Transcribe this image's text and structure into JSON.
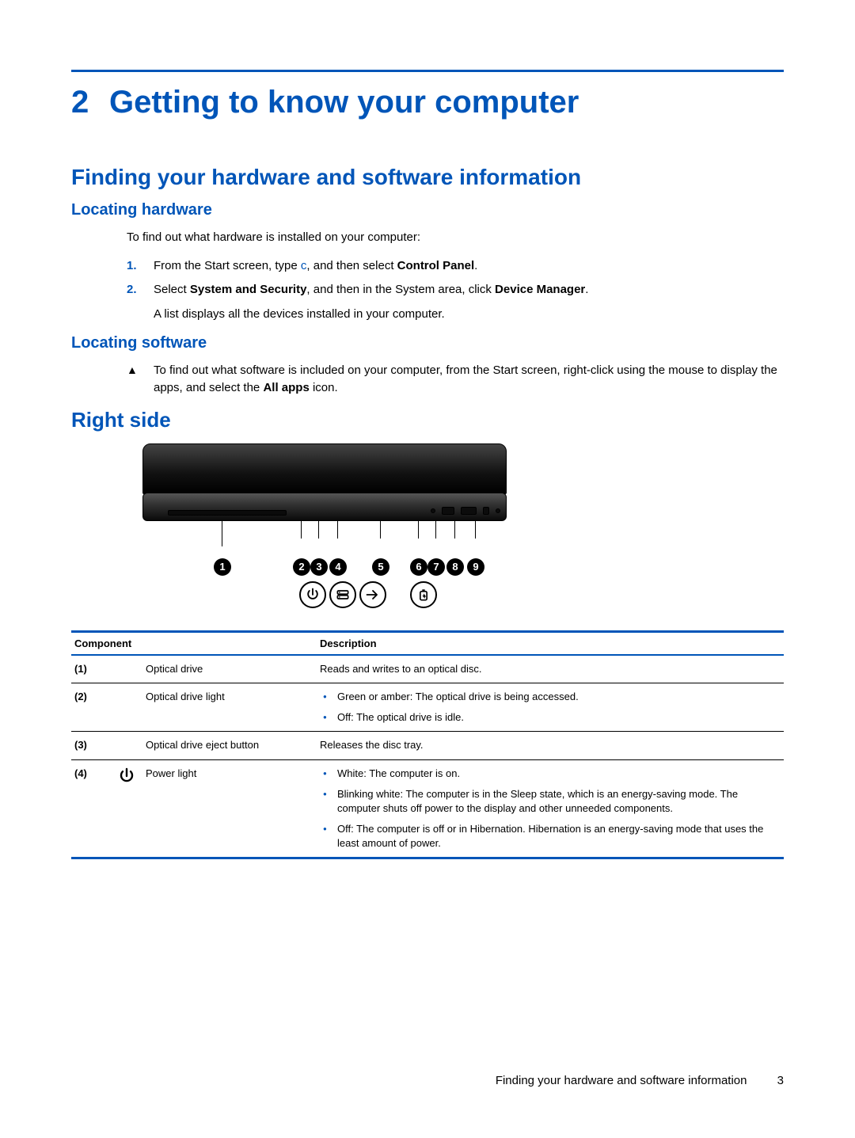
{
  "chapter": {
    "number": "2",
    "title": "Getting to know your computer"
  },
  "section1": {
    "title": "Finding your hardware and software information",
    "sub1": {
      "title": "Locating hardware",
      "intro": "To find out what hardware is installed on your computer:",
      "steps": [
        {
          "n": "1.",
          "pre": "From the Start screen, type ",
          "code": "c",
          "post1": ", and then select ",
          "bold1": "Control Panel",
          "tail": "."
        },
        {
          "n": "2.",
          "pre": "Select ",
          "bold1": "System and Security",
          "mid": ", and then in the System area, click ",
          "bold2": "Device Manager",
          "tail": "."
        }
      ],
      "after": "A list displays all the devices installed in your computer."
    },
    "sub2": {
      "title": "Locating software",
      "note_pre": "To find out what software is included on your computer, from the Start screen, right-click using the mouse to display the apps, and select the ",
      "note_bold": "All apps",
      "note_post": " icon."
    }
  },
  "section2": {
    "title": "Right side"
  },
  "callouts": [
    "1",
    "2",
    "3",
    "4",
    "5",
    "6",
    "7",
    "8",
    "9"
  ],
  "table": {
    "headers": {
      "component": "Component",
      "description": "Description"
    },
    "rows": [
      {
        "num": "(1)",
        "name": "Optical drive",
        "desc_plain": "Reads and writes to an optical disc."
      },
      {
        "num": "(2)",
        "name": "Optical drive light",
        "desc_list": [
          "Green or amber: The optical drive is being accessed.",
          "Off: The optical drive is idle."
        ]
      },
      {
        "num": "(3)",
        "name": "Optical drive eject button",
        "desc_plain": "Releases the disc tray."
      },
      {
        "num": "(4)",
        "name": "Power light",
        "has_icon": true,
        "desc_list": [
          "White: The computer is on.",
          "Blinking white: The computer is in the Sleep state, which is an energy-saving mode. The computer shuts off power to the display and other unneeded components.",
          "Off: The computer is off or in Hibernation. Hibernation is an energy-saving mode that uses the least amount of power."
        ]
      }
    ]
  },
  "footer": {
    "text": "Finding your hardware and software information",
    "page": "3"
  }
}
